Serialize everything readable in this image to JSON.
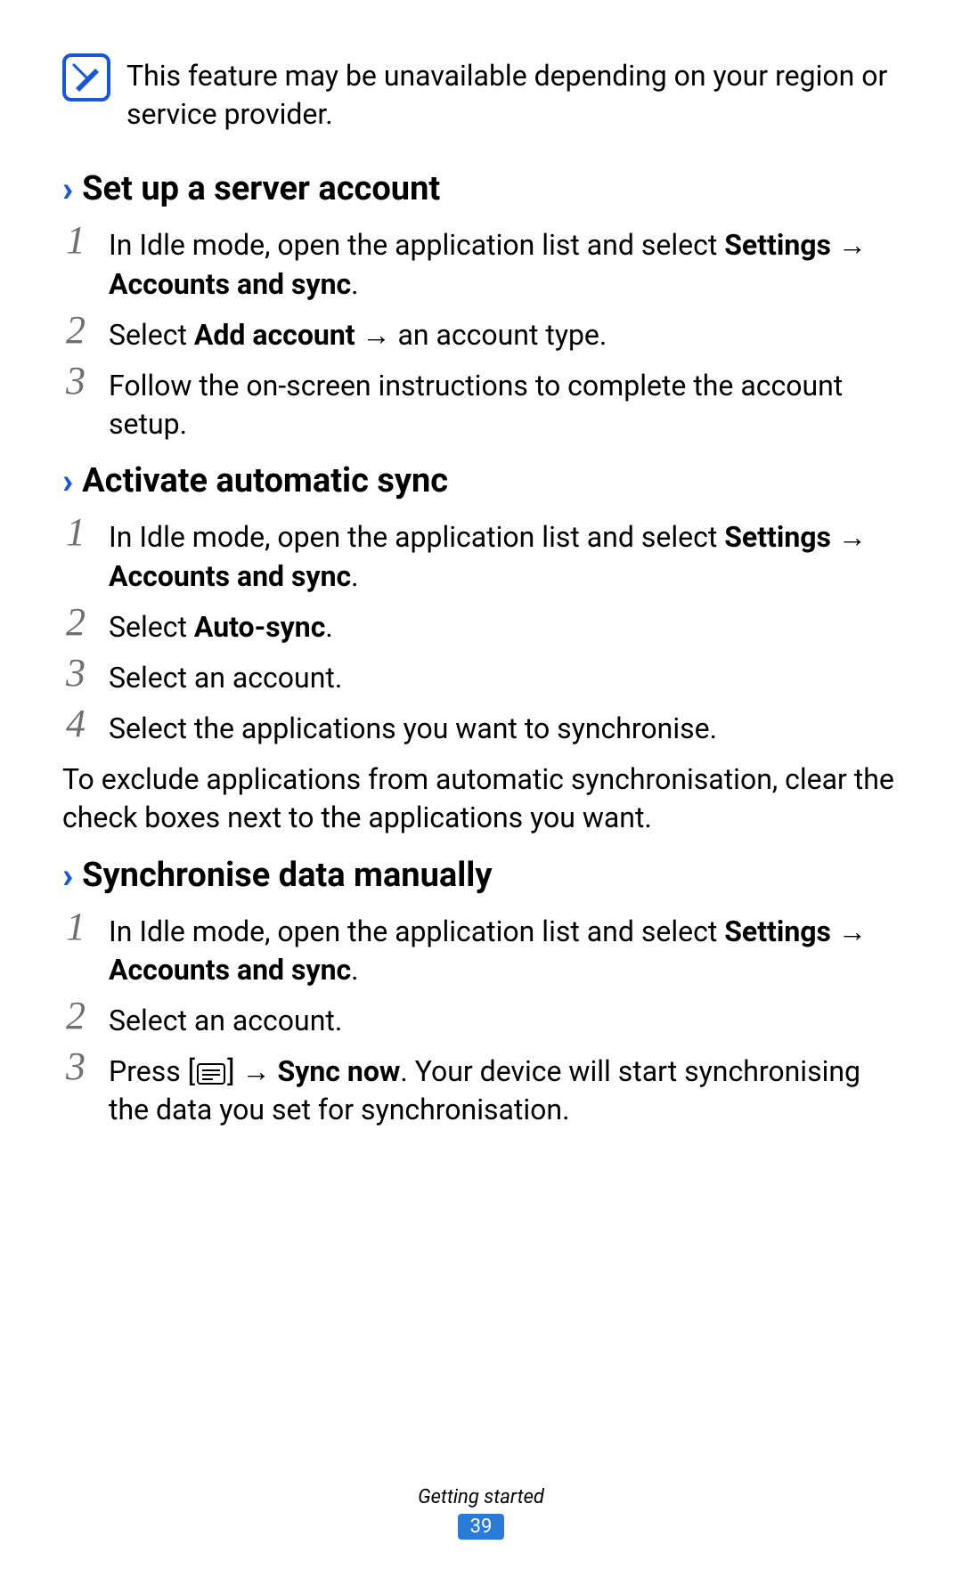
{
  "note": {
    "text": "This feature may be unavailable depending on your region or service provider."
  },
  "sections": {
    "s1": {
      "title": "Set up a server account",
      "steps": {
        "n1": "1",
        "t1a": "In Idle mode, open the application list and select ",
        "t1b": "Settings",
        "t1c": " → ",
        "t1d": "Accounts and sync",
        "t1e": ".",
        "n2": "2",
        "t2a": "Select ",
        "t2b": "Add account",
        "t2c": " → an account type.",
        "n3": "3",
        "t3": "Follow the on-screen instructions to complete the account setup."
      }
    },
    "s2": {
      "title": "Activate automatic sync",
      "steps": {
        "n1": "1",
        "t1a": "In Idle mode, open the application list and select ",
        "t1b": "Settings",
        "t1c": " → ",
        "t1d": "Accounts and sync",
        "t1e": ".",
        "n2": "2",
        "t2a": "Select ",
        "t2b": "Auto-sync",
        "t2c": ".",
        "n3": "3",
        "t3": "Select an account.",
        "n4": "4",
        "t4": "Select the applications you want to synchronise."
      },
      "body": "To exclude applications from automatic synchronisation, clear the check boxes next to the applications you want."
    },
    "s3": {
      "title": "Synchronise data manually",
      "steps": {
        "n1": "1",
        "t1a": "In Idle mode, open the application list and select ",
        "t1b": "Settings",
        "t1c": " → ",
        "t1d": "Accounts and sync",
        "t1e": ".",
        "n2": "2",
        "t2": "Select an account.",
        "n3": "3",
        "t3a": "Press [",
        "t3b": "] → ",
        "t3c": "Sync now",
        "t3d": ". Your device will start synchronising the data you set for synchronisation."
      }
    }
  },
  "footer": {
    "chapter": "Getting started",
    "page": "39"
  }
}
